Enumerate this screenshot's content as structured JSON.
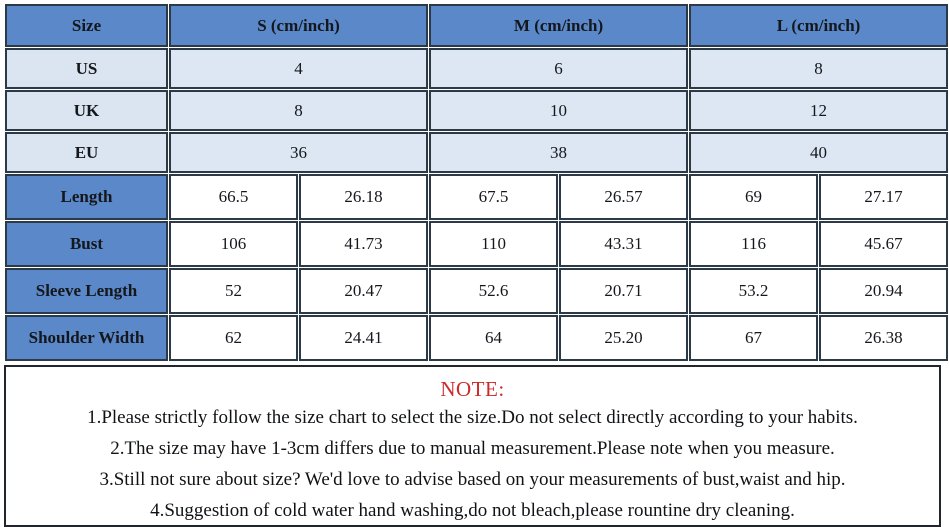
{
  "table": {
    "columns": [
      {
        "key": "label",
        "label": "Size"
      },
      {
        "key": "s",
        "label": "S (cm/inch)"
      },
      {
        "key": "m",
        "label": "M (cm/inch)"
      },
      {
        "key": "l",
        "label": "L (cm/inch)"
      }
    ],
    "conversion_rows": [
      {
        "label": "US",
        "s": "4",
        "m": "6",
        "l": "8"
      },
      {
        "label": "UK",
        "s": "8",
        "m": "10",
        "l": "12"
      },
      {
        "label": "EU",
        "s": "36",
        "m": "38",
        "l": "40"
      }
    ],
    "measurement_rows": [
      {
        "label": "Length",
        "s_cm": "66.5",
        "s_in": "26.18",
        "m_cm": "67.5",
        "m_in": "26.57",
        "l_cm": "69",
        "l_in": "27.17"
      },
      {
        "label": "Bust",
        "s_cm": "106",
        "s_in": "41.73",
        "m_cm": "110",
        "m_in": "43.31",
        "l_cm": "116",
        "l_in": "45.67"
      },
      {
        "label": "Sleeve Length",
        "s_cm": "52",
        "s_in": "20.47",
        "m_cm": "52.6",
        "m_in": "20.71",
        "l_cm": "53.2",
        "l_in": "20.94"
      },
      {
        "label": "Shoulder Width",
        "s_cm": "62",
        "s_in": "24.41",
        "m_cm": "64",
        "m_in": "25.20",
        "l_cm": "67",
        "l_in": "26.38"
      }
    ]
  },
  "note": {
    "title": "NOTE:",
    "lines": [
      "1.Please strictly follow the size chart to select the size.Do not select directly according to your habits.",
      "2.The size may have 1-3cm differs due to manual measurement.Please note when you measure.",
      "3.Still not sure about size? We'd love to advise based on your measurements of bust,waist and hip.",
      "4.Suggestion of cold water hand washing,do not bleach,please rountine dry cleaning."
    ]
  },
  "colors": {
    "header_blue": "#5b88c9",
    "light_blue": "#dce6f2",
    "cell_white": "#ffffff",
    "border": "#2b3a46",
    "note_red": "#cc2b2b",
    "text": "#14171c"
  }
}
